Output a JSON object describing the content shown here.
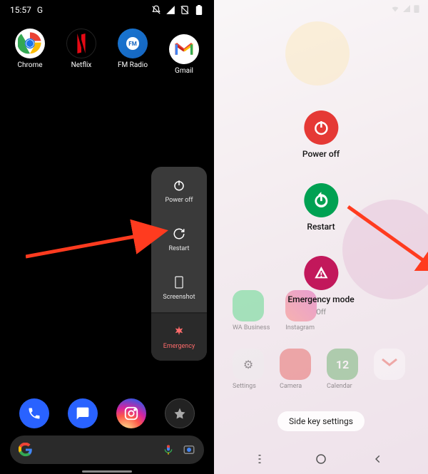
{
  "left_phone": {
    "status": {
      "time": "15:57",
      "indicator": "G"
    },
    "apps": {
      "chrome": "Chrome",
      "netflix": "Netflix",
      "fmradio": "FM Radio",
      "fmradio_badge": "FM",
      "gmail": "Gmail"
    },
    "power_menu": {
      "power_off": "Power off",
      "restart": "Restart",
      "screenshot": "Screenshot",
      "emergency": "Emergency"
    }
  },
  "right_phone": {
    "power_menu": {
      "power_off": "Power off",
      "restart": "Restart",
      "emergency": "Emergency mode",
      "emergency_sub": "Off"
    },
    "bg_apps": {
      "wa_business": "WA Business",
      "instagram": "Instagram",
      "settings": "Settings",
      "camera": "Camera",
      "calendar": "Calendar",
      "calendar_day": "12"
    },
    "side_key": "Side key settings"
  }
}
